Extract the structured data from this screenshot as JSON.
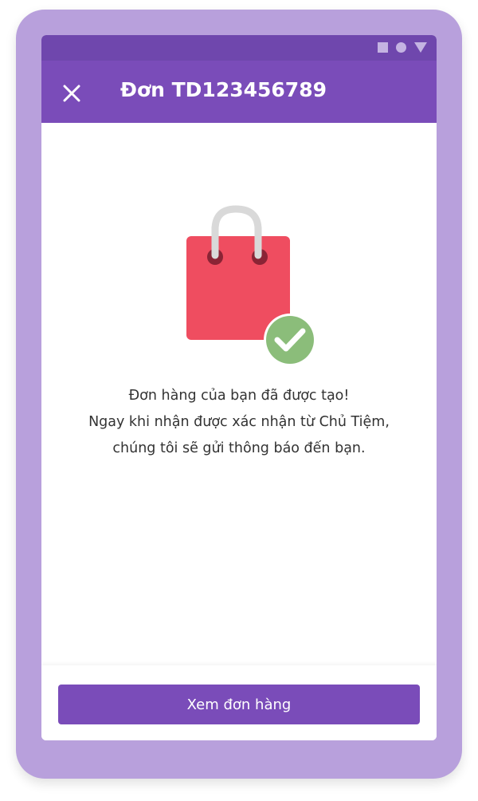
{
  "status_bar": {
    "icons": [
      "square-icon",
      "circle-icon",
      "triangle-icon"
    ]
  },
  "app_bar": {
    "title": "Đơn TD123456789",
    "close_icon": "close-icon"
  },
  "confirmation": {
    "illustration": "shopping-bag-check-icon",
    "line1": "Đơn hàng của bạn đã được tạo!",
    "line2": "Ngay khi nhận được xác nhận từ Chủ Tiệm,",
    "line3": "chúng tôi sẽ gửi thông báo đến bạn."
  },
  "footer": {
    "view_order_label": "Xem đơn hàng"
  },
  "colors": {
    "frame": "#b8a0dc",
    "status_bar": "#6f47ad",
    "primary": "#7a4cb9",
    "bag": "#ef4d60",
    "check": "#8bbd7a"
  }
}
